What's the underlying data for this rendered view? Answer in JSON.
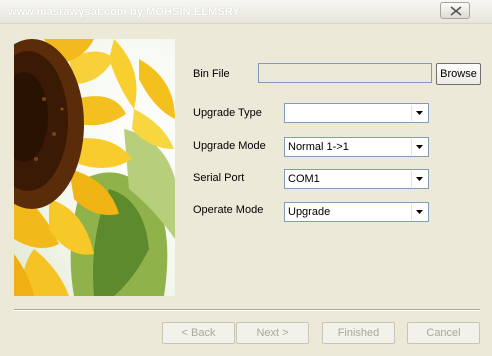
{
  "window": {
    "title": "www.masrawysat.com by MOHSIN ELMSRY",
    "accent": "#7f9db9"
  },
  "form": {
    "bin_file": {
      "label": "Bin File",
      "value": "",
      "browse_label": "Browse"
    },
    "upgrade_type": {
      "label": "Upgrade Type",
      "value": ""
    },
    "upgrade_mode": {
      "label": "Upgrade Mode",
      "value": "Normal 1->1"
    },
    "serial_port": {
      "label": "Serial Port",
      "value": "COM1"
    },
    "operate_mode": {
      "label": "Operate Mode",
      "value": "Upgrade"
    }
  },
  "footer": {
    "back_label": "< Back",
    "next_label": "Next >",
    "finished_label": "Finished",
    "cancel_label": "Cancel"
  }
}
